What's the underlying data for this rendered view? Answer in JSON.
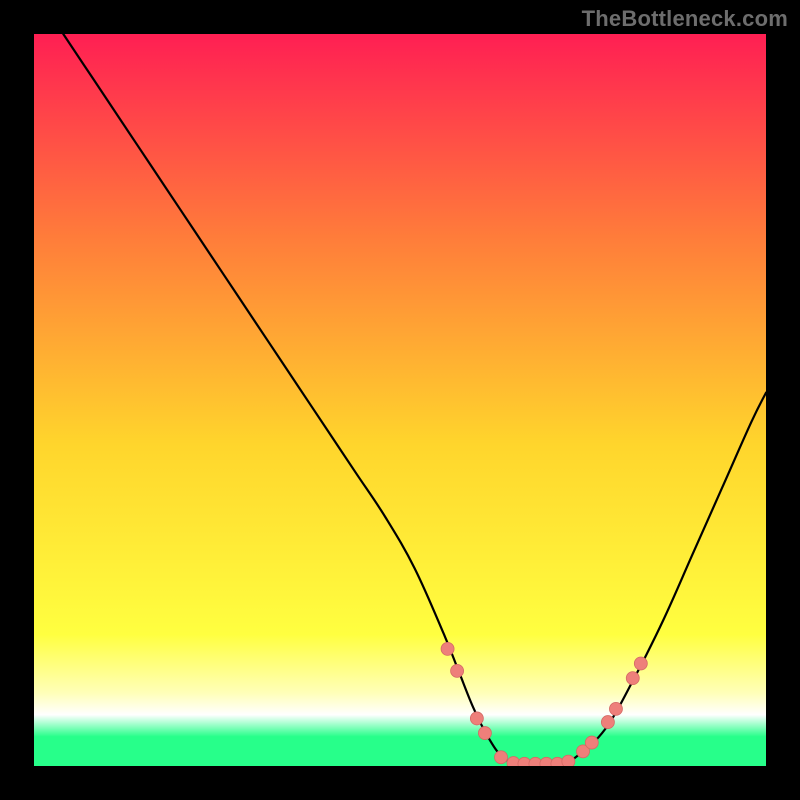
{
  "watermark": "TheBottleneck.com",
  "colors": {
    "background": "#000000",
    "gradient_top": "#ff1f53",
    "gradient_mid_upper": "#ff7d3a",
    "gradient_mid": "#ffd52c",
    "gradient_mid_lower": "#ffff40",
    "gradient_pale": "#ffffb8",
    "gradient_green": "#27ff8a",
    "curve_stroke": "#000000",
    "marker_fill": "#ee7f7a",
    "marker_stroke": "#d46a65"
  },
  "chart_data": {
    "type": "line",
    "title": "",
    "xlabel": "",
    "ylabel": "",
    "xlim": [
      0,
      100
    ],
    "ylim": [
      0,
      100
    ],
    "series": [
      {
        "name": "bottleneck-curve",
        "x": [
          4,
          8,
          12,
          16,
          20,
          24,
          28,
          32,
          36,
          40,
          44,
          48,
          52,
          56,
          58,
          60,
          62,
          64,
          66,
          68,
          70,
          72,
          74,
          78,
          82,
          86,
          90,
          94,
          98,
          100
        ],
        "y": [
          100,
          94,
          88,
          82,
          76,
          70,
          64,
          58,
          52,
          46,
          40,
          34,
          27,
          18,
          13,
          8,
          4,
          1.2,
          0.4,
          0.3,
          0.3,
          0.4,
          1.2,
          5,
          12,
          20,
          29,
          38,
          47,
          51
        ]
      }
    ],
    "markers": [
      {
        "x": 56.5,
        "y": 16
      },
      {
        "x": 57.8,
        "y": 13
      },
      {
        "x": 60.5,
        "y": 6.5
      },
      {
        "x": 61.6,
        "y": 4.5
      },
      {
        "x": 63.8,
        "y": 1.2
      },
      {
        "x": 65.5,
        "y": 0.4
      },
      {
        "x": 67.0,
        "y": 0.3
      },
      {
        "x": 68.5,
        "y": 0.3
      },
      {
        "x": 70.0,
        "y": 0.3
      },
      {
        "x": 71.5,
        "y": 0.3
      },
      {
        "x": 73.0,
        "y": 0.6
      },
      {
        "x": 75.0,
        "y": 2.0
      },
      {
        "x": 76.2,
        "y": 3.2
      },
      {
        "x": 78.4,
        "y": 6.0
      },
      {
        "x": 79.5,
        "y": 7.8
      },
      {
        "x": 81.8,
        "y": 12.0
      },
      {
        "x": 82.9,
        "y": 14.0
      }
    ]
  }
}
